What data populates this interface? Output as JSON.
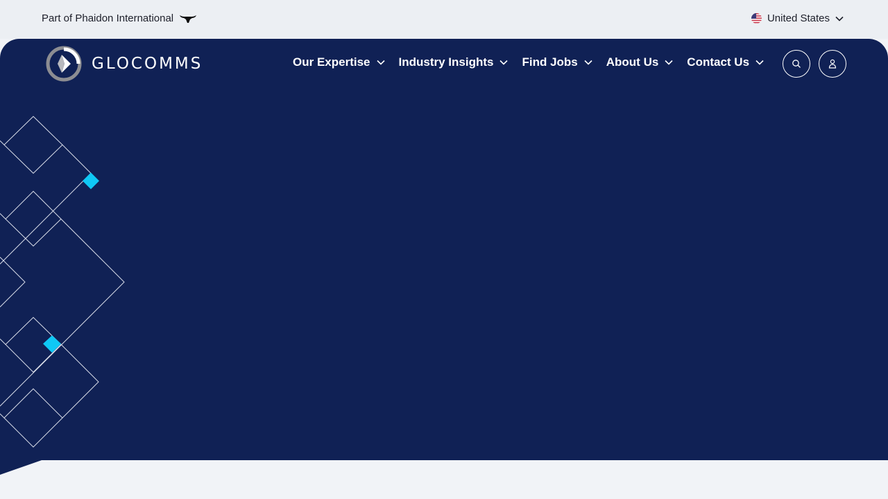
{
  "topbar": {
    "parent_label": "Part of Phaidon International",
    "parent_icon": "bull-icon",
    "region_label": "United States",
    "region_icon": "us-flag-icon"
  },
  "header": {
    "logo_text": "GLOCOMMS",
    "logo_icon": "glocomms-logo-icon",
    "nav": [
      {
        "label": "Our Expertise"
      },
      {
        "label": "Industry Insights"
      },
      {
        "label": "Find Jobs"
      },
      {
        "label": "About Us"
      },
      {
        "label": "Contact Us"
      }
    ],
    "search_icon": "search-icon",
    "account_icon": "user-icon"
  },
  "colors": {
    "hero_bg": "#102155",
    "accent": "#0fc8f5",
    "topbar_bg": "#eceff3",
    "page_bg": "#f1f3f7"
  }
}
